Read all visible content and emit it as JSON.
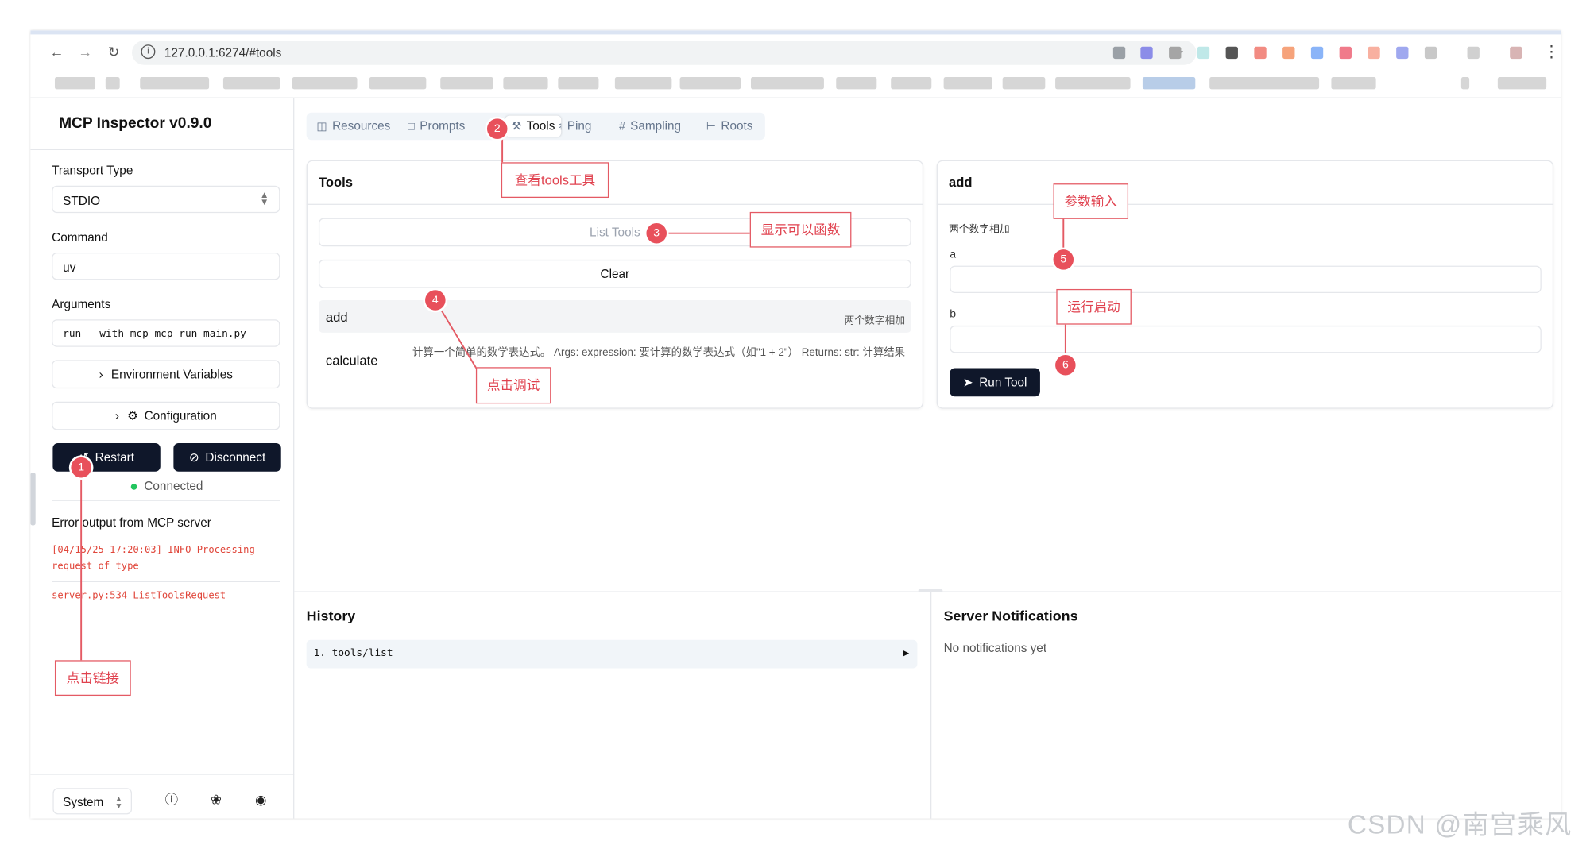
{
  "browser": {
    "url": "127.0.0.1:6274/#tools",
    "nav_icons": [
      "back-arrow-icon",
      "forward-arrow-icon",
      "reload-icon"
    ]
  },
  "sidebar": {
    "title": "MCP Inspector v0.9.0",
    "transport_label": "Transport Type",
    "transport_value": "STDIO",
    "command_label": "Command",
    "command_value": "uv",
    "arguments_label": "Arguments",
    "arguments_value": "run --with mcp mcp run main.py",
    "env_vars_label": "Environment Variables",
    "configuration_label": "Configuration",
    "restart_label": "Restart",
    "disconnect_label": "Disconnect",
    "status_text": "Connected",
    "status_color": "#22c55e",
    "error_heading": "Error output from MCP server",
    "error_lines": [
      "[04/15/25 17:20:03] INFO Processing request of type",
      "server.py:534 ListToolsRequest"
    ],
    "theme_value": "System"
  },
  "tabs": [
    {
      "label": "Resources",
      "icon": "resources-icon"
    },
    {
      "label": "Prompts",
      "icon": "prompts-icon"
    },
    {
      "label": "Tools",
      "icon": "tools-icon"
    },
    {
      "label": "Ping",
      "icon": "bell-icon"
    },
    {
      "label": "Sampling",
      "icon": "hash-icon"
    },
    {
      "label": "Roots",
      "icon": "tree-icon"
    }
  ],
  "tools_panel": {
    "title": "Tools",
    "list_button": "List Tools",
    "clear_button": "Clear",
    "tools": [
      {
        "name": "add",
        "description": "两个数字相加"
      },
      {
        "name": "calculate",
        "description": "计算一个简单的数学表达式。 Args: expression: 要计算的数学表达式（如\"1 + 2\"） Returns: str: 计算结果"
      }
    ]
  },
  "tool_detail": {
    "title": "add",
    "description": "两个数字相加",
    "param_a_label": "a",
    "param_b_label": "b",
    "run_button": "Run Tool"
  },
  "history": {
    "title": "History",
    "items": [
      "1. tools/list"
    ]
  },
  "notifications": {
    "title": "Server Notifications",
    "empty_text": "No notifications yet"
  },
  "annotations": [
    {
      "num": "1",
      "text": "点击链接"
    },
    {
      "num": "2",
      "text": "查看tools工具"
    },
    {
      "num": "3",
      "text": "显示可以函数"
    },
    {
      "num": "4",
      "text": "点击调试"
    },
    {
      "num": "5",
      "text": "参数输入"
    },
    {
      "num": "6",
      "text": "运行启动"
    }
  ],
  "annotation_color": "#e8505b",
  "accent_dark": "#0f172a",
  "watermark": "CSDN @南宫乘风"
}
